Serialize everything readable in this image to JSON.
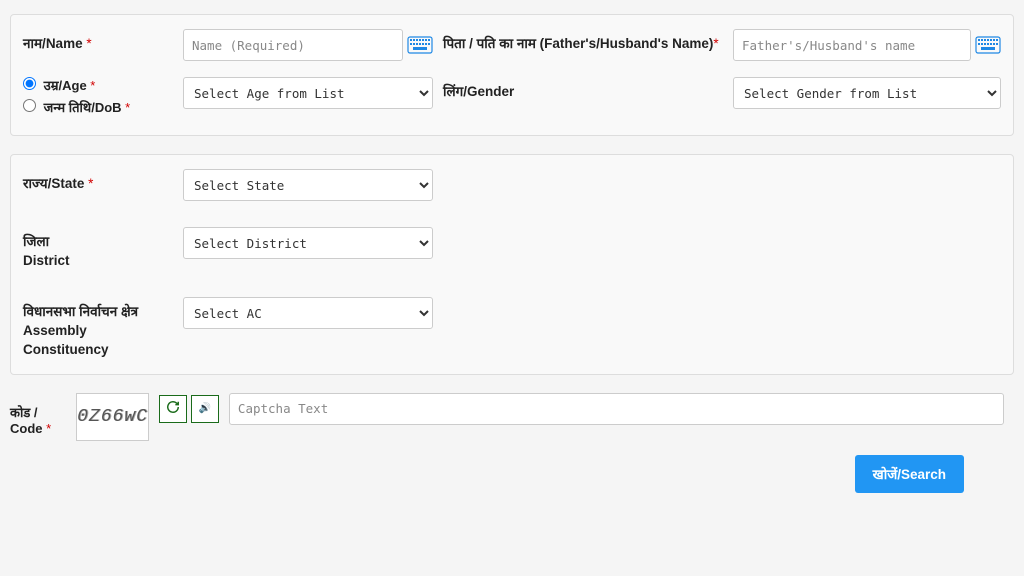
{
  "labels": {
    "name": "नाम/Name ",
    "father": "पिता / पति का नाम (Father's/Husband's Name)",
    "age": " उम्र/Age ",
    "dob": " जन्म तिथि/DoB ",
    "gender": "लिंग/Gender",
    "state": "राज्य/State ",
    "district_hi": "जिला",
    "district_en": "District",
    "ac_hi": "विधानसभा निर्वाचन क्षेत्र",
    "ac_en1": "Assembly",
    "ac_en2": "Constituency",
    "code": "कोड / Code "
  },
  "placeholders": {
    "name": "Name (Required)",
    "father": "Father's/Husband's name",
    "captcha": "Captcha Text"
  },
  "selects": {
    "age": "Select Age from List",
    "gender": "Select Gender from List",
    "state": "Select State",
    "district": "Select District",
    "ac": "Select AC"
  },
  "captcha": {
    "value": "0Z66wC"
  },
  "buttons": {
    "search": "खोजें/Search"
  },
  "req": "*"
}
